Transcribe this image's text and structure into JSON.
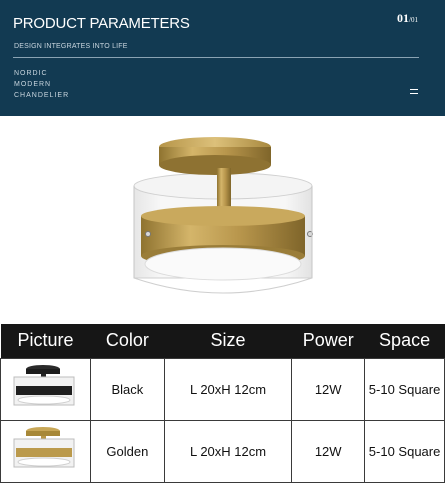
{
  "header": {
    "title": "PRODUCT PARAMETERS",
    "subtitle": "DESIGN INTEGRATES INTO LIFE",
    "tags": [
      "NORDIC",
      "MODERN",
      "CHANDELIER"
    ],
    "page_number": "01",
    "page_total": "/01",
    "background_color": "#123a52"
  },
  "table": {
    "headers": [
      "Picture",
      "Color",
      "Size",
      "Power",
      "Space"
    ],
    "rows": [
      {
        "color": "Black",
        "size": "L 20xH 12cm",
        "power": "12W",
        "space": "5-10 Square"
      },
      {
        "color": "Golden",
        "size": "L 20xH 12cm",
        "power": "12W",
        "space": "5-10 Square"
      }
    ]
  }
}
